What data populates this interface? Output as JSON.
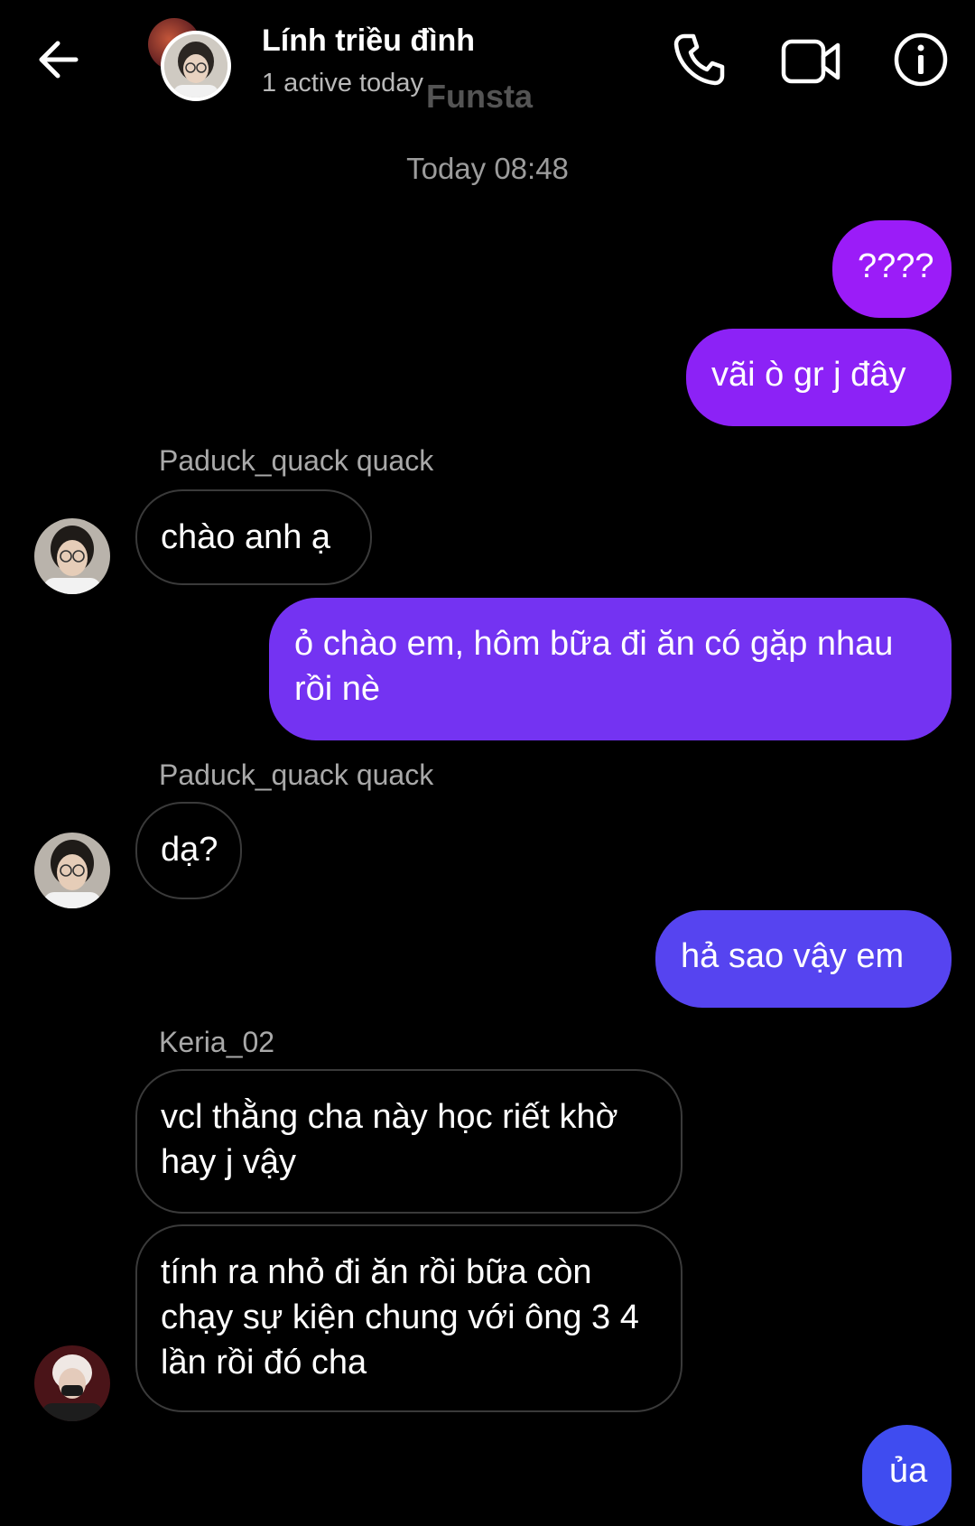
{
  "header": {
    "contact_name": "Lính triều đình",
    "status": "1 active today",
    "watermark": "Funsta",
    "icons": [
      "back-arrow-icon",
      "phone-icon",
      "video-camera-icon",
      "info-icon"
    ]
  },
  "conversation": {
    "timestamp": "Today 08:48",
    "messages": [
      {
        "direction": "out",
        "text": "????"
      },
      {
        "direction": "out",
        "text": "vãi ò gr j đây"
      },
      {
        "direction": "in",
        "sender": "Paduck_quack quack",
        "text": "chào anh ạ"
      },
      {
        "direction": "out",
        "text": "ỏ chào em, hôm bữa đi ăn có gặp nhau rồi nè"
      },
      {
        "direction": "in",
        "sender": "Paduck_quack quack",
        "text": "dạ?"
      },
      {
        "direction": "out",
        "text": "hả sao vậy em"
      },
      {
        "direction": "in",
        "sender": "Keria_02",
        "text": "vcl thằng cha này học riết khờ hay j vậy"
      },
      {
        "direction": "in",
        "sender": "Keria_02",
        "text": "tính ra nhỏ đi ăn rồi bữa còn chạy sự kiện chung với ông 3 4 lần rồi đó cha"
      },
      {
        "direction": "out",
        "text": "ủa"
      }
    ]
  },
  "colors": {
    "background": "#000000",
    "outgoing_top": "#9b1cf8",
    "outgoing_mid": "#6a35ee",
    "outgoing_bottom": "#3f4cf0",
    "incoming_border": "#3a3a3a",
    "muted_text": "#a9a9a9"
  }
}
